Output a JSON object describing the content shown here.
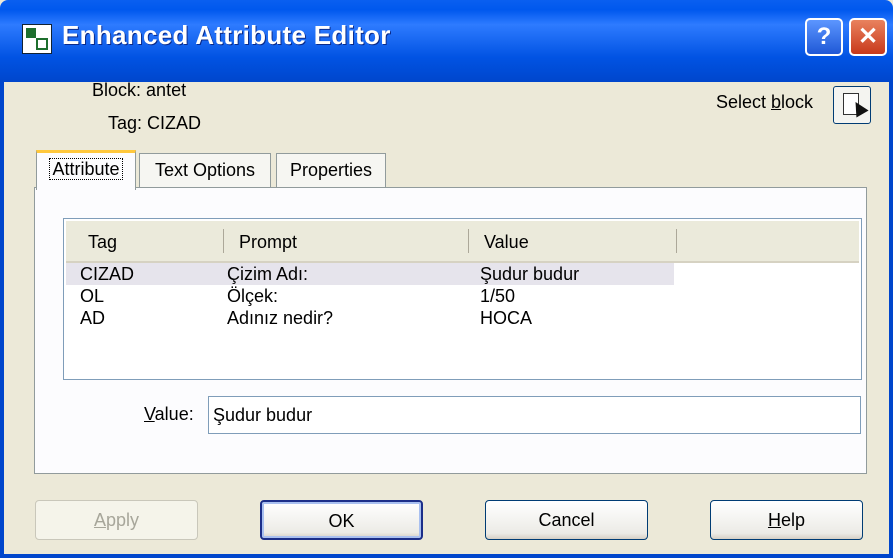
{
  "window": {
    "title": "Enhanced Attribute Editor",
    "help_glyph": "?",
    "close_glyph": "✕",
    "icon": "app-icon"
  },
  "header": {
    "block_label": "Block:",
    "block_value": "antet",
    "tag_label": "Tag:",
    "tag_value": "CIZAD",
    "select_pre": "Select ",
    "select_key": "b",
    "select_post": "lock",
    "select_icon": "select-block-icon"
  },
  "tabs": [
    {
      "label": "Attribute",
      "active": true
    },
    {
      "label": "Text Options",
      "active": false
    },
    {
      "label": "Properties",
      "active": false
    }
  ],
  "table": {
    "columns": [
      "Tag",
      "Prompt",
      "Value"
    ],
    "rows": [
      {
        "tag": "CIZAD",
        "prompt": "Çizim Adı:",
        "value": "Şudur budur",
        "selected": true
      },
      {
        "tag": "OL",
        "prompt": "Ölçek:",
        "value": "1/50",
        "selected": false
      },
      {
        "tag": "AD",
        "prompt": "Adınız nedir?",
        "value": "HOCA",
        "selected": false
      }
    ]
  },
  "value_field": {
    "label_key": "V",
    "label_rest": "alue:",
    "value": "Şudur budur"
  },
  "buttons": {
    "apply_key": "A",
    "apply_rest": "pply",
    "ok": "OK",
    "cancel": "Cancel",
    "help_key": "H",
    "help_rest": "elp"
  },
  "colors": {
    "titlebar": "#0058EE",
    "dialog_bg": "#ECE9D8",
    "selected_row": "#E6E4EC",
    "close_button": "#C8391B"
  }
}
